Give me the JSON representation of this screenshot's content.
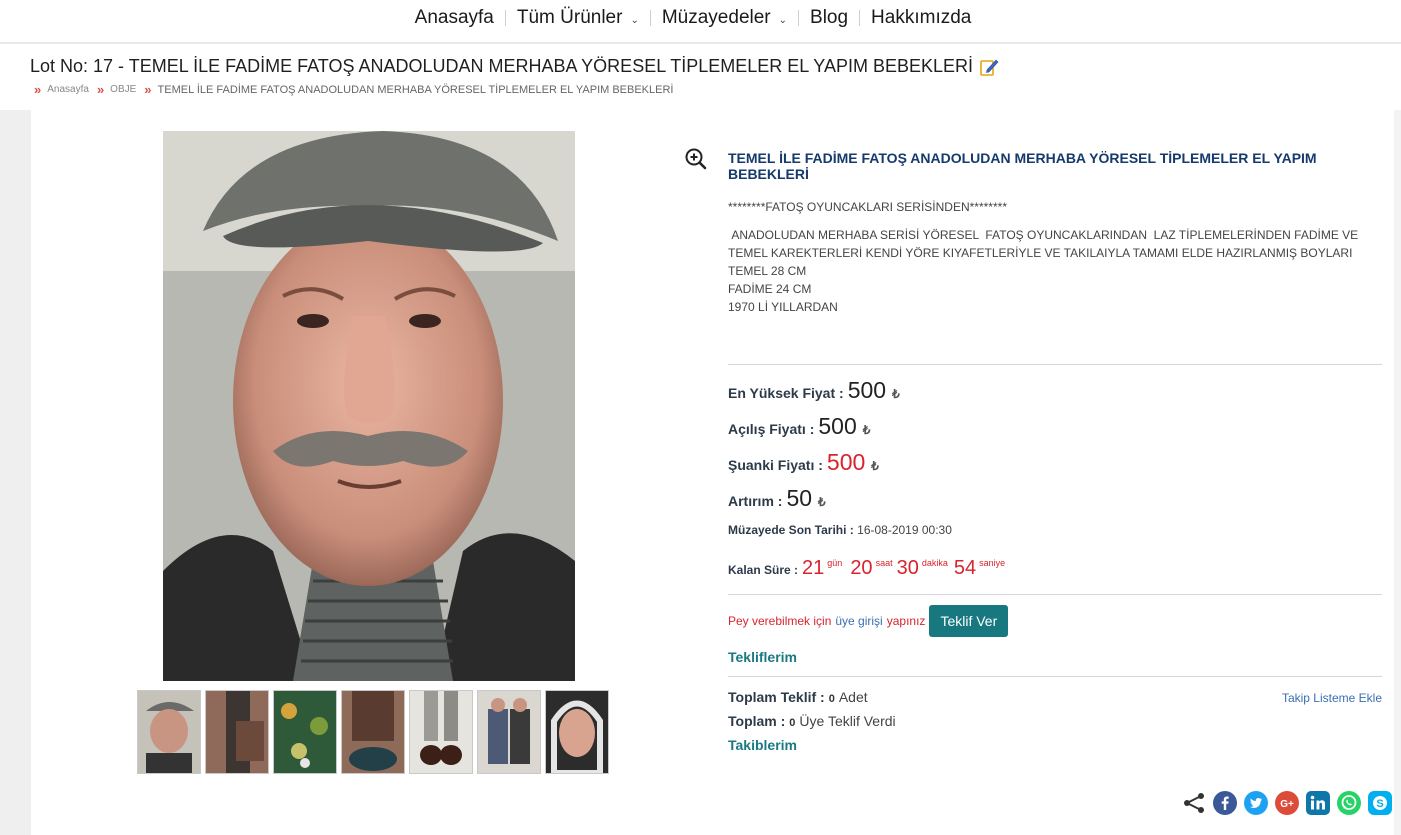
{
  "nav": {
    "items": [
      {
        "label": "Anasayfa"
      },
      {
        "label": "Tüm Ürünler"
      },
      {
        "label": "Müzayedeler"
      },
      {
        "label": "Blog"
      },
      {
        "label": "Hakkımızda"
      }
    ]
  },
  "lot": {
    "title": "Lot No: 17 - TEMEL İLE FADİME FATOŞ ANADOLUDAN MERHABA YÖRESEL TİPLEMELER EL YAPIM BEBEKLERİ"
  },
  "breadcrumb": {
    "items": [
      "Anasayfa",
      "OBJE"
    ],
    "current": "TEMEL İLE FADİME FATOŞ ANADOLUDAN MERHABA YÖRESEL TİPLEMELER EL YAPIM BEBEKLERİ"
  },
  "product": {
    "title": "TEMEL İLE FADİME FATOŞ ANADOLUDAN MERHABA YÖRESEL TİPLEMELER EL YAPIM BEBEKLERİ",
    "series_line": "********FATOŞ OYUNCAKLARI SERİSİNDEN********",
    "desc_lines": [
      " ANADOLUDAN MERHABA SERİSİ YÖRESEL  FATOŞ OYUNCAKLARINDAN  LAZ TİPLEMELERİNDEN FADİME VE TEMEL KAREKTERLERİ KENDİ YÖRE KIYAFETLERİYLE VE TAKILAIYLA TAMAMI ELDE HAZIRLANMIŞ BOYLARI",
      "TEMEL 28 CM",
      "FADİME 24  CM",
      "1970 Lİ YILLARDAN"
    ]
  },
  "prices": {
    "highest_label": "En Yüksek Fiyat :",
    "highest_value": "500",
    "opening_label": "Açılış Fiyatı :",
    "opening_value": "500",
    "current_label": "Şuanki Fiyatı :",
    "current_value": "500",
    "increment_label": "Artırım :",
    "increment_value": "50",
    "currency": "₺"
  },
  "deadline": {
    "label": "Müzayede Son Tarihi :",
    "value": "16-08-2019 00:30"
  },
  "countdown": {
    "label": "Kalan Süre :",
    "days": "21",
    "days_unit": "gün",
    "hours": "20",
    "hours_unit": "saat",
    "minutes": "30",
    "minutes_unit": "dakika",
    "seconds": "54",
    "seconds_unit": "saniye"
  },
  "bid": {
    "prefix": "Pey verebilmek için",
    "login_link": "üye girişi",
    "suffix": "yapınız",
    "button": "Teklif Ver"
  },
  "links": {
    "my_bids": "Tekliflerim",
    "my_follows": "Takiblerim",
    "follow_list": "Takip Listeme Ekle"
  },
  "stats": {
    "total_bids_label": "Toplam Teklif :",
    "total_bids_value": "0",
    "total_bids_unit": "Adet",
    "total_label": "Toplam :",
    "total_value": "0",
    "total_unit": "Üye Teklif Verdi"
  },
  "colors": {
    "accent_red": "#d9232d",
    "title_blue": "#163a6b",
    "teal": "#17787f"
  }
}
